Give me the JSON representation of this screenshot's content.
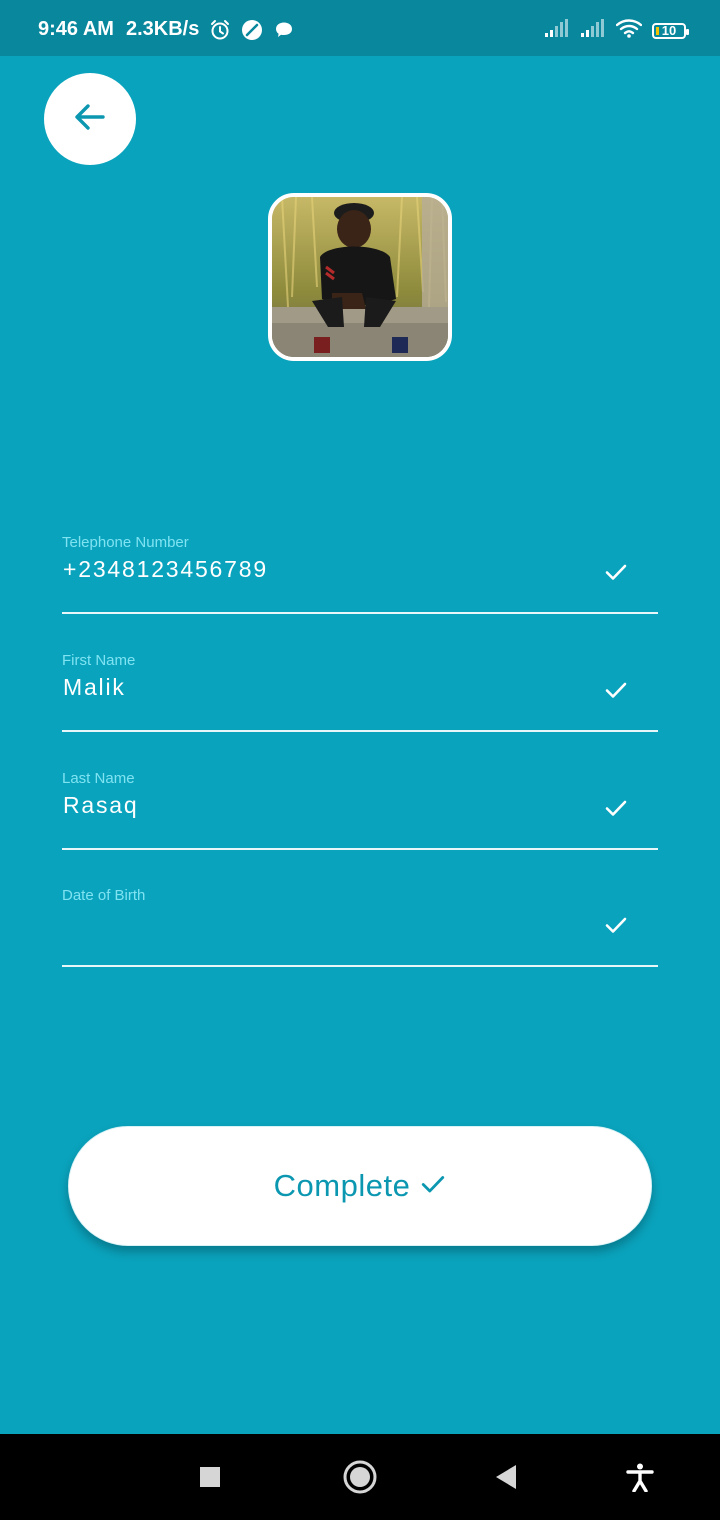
{
  "status_bar": {
    "time": "9:46 AM",
    "net_speed": "2.3KB/s",
    "battery_level": "10",
    "icons": [
      "alarm-icon",
      "no-disturb-icon",
      "chat-bubble-icon",
      "signal-icon",
      "signal-icon",
      "wifi-icon",
      "battery-icon"
    ]
  },
  "header": {
    "back_icon": "arrow-left-icon"
  },
  "form": {
    "fields": [
      {
        "label": "Telephone Number",
        "value": "+2348123456789"
      },
      {
        "label": "First Name",
        "value": "Malik"
      },
      {
        "label": "Last Name",
        "value": "Rasaq"
      },
      {
        "label": "Date of Birth",
        "value": ""
      }
    ]
  },
  "actions": {
    "complete_label": "Complete"
  },
  "nav": {
    "icons": [
      "recents-square-icon",
      "home-circle-icon",
      "back-triangle-icon",
      "accessibility-icon"
    ]
  },
  "colors": {
    "background": "#0aa3bd",
    "status_bar": "#08879d",
    "accent": "#0c97b1",
    "label": "#7fe3f2",
    "white": "#ffffff"
  }
}
